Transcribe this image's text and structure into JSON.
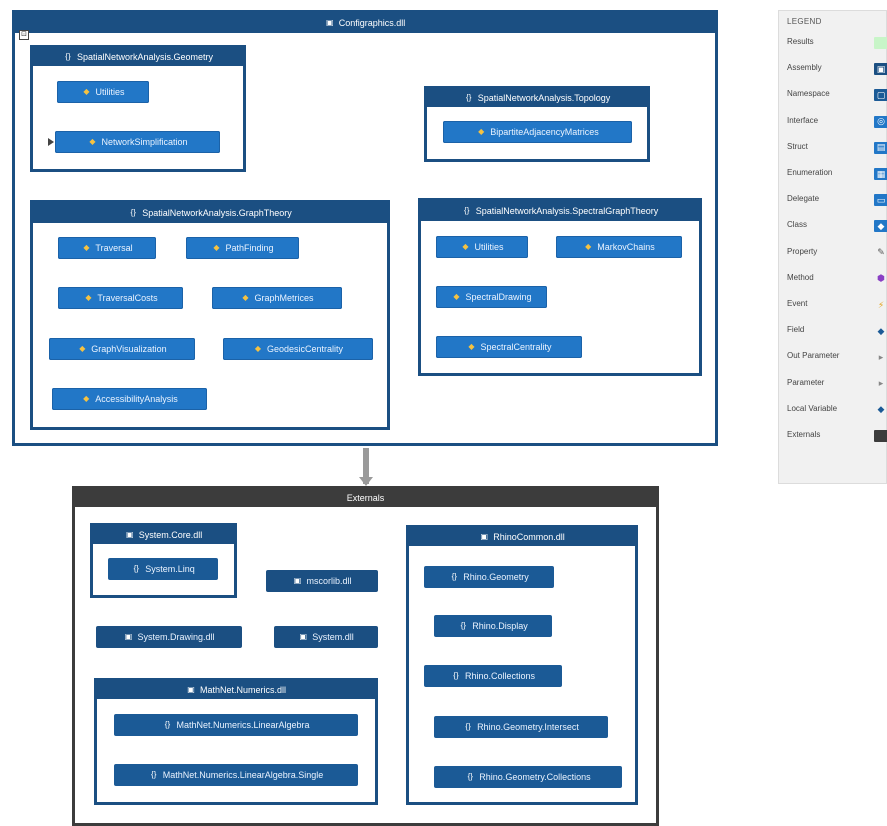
{
  "main_assembly": {
    "title": "Configraphics.dll",
    "geometry_ns": {
      "title": "SpatialNetworkAnalysis.Geometry",
      "classes": [
        "Utilities",
        "NetworkSimplification"
      ]
    },
    "topology_ns": {
      "title": "SpatialNetworkAnalysis.Topology",
      "classes": [
        "BipartiteAdjacencyMatrices"
      ]
    },
    "graphtheory_ns": {
      "title": "SpatialNetworkAnalysis.GraphTheory",
      "classes": [
        "Traversal",
        "PathFinding",
        "TraversalCosts",
        "GraphMetrices",
        "GraphVisualization",
        "GeodesicCentrality",
        "AccessibilityAnalysis"
      ]
    },
    "spectral_ns": {
      "title": "SpatialNetworkAnalysis.SpectralGraphTheory",
      "classes": [
        "Utilities",
        "MarkovChains",
        "SpectralDrawing",
        "SpectralCentrality"
      ]
    }
  },
  "externals": {
    "title": "Externals",
    "system_core": {
      "title": "System.Core.dll",
      "namespaces": [
        "System.Linq"
      ]
    },
    "mscorlib": "mscorlib.dll",
    "system_drawing": "System.Drawing.dll",
    "system": "System.dll",
    "mathnet": {
      "title": "MathNet.Numerics.dll",
      "namespaces": [
        "MathNet.Numerics.LinearAlgebra",
        "MathNet.Numerics.LinearAlgebra.Single"
      ]
    },
    "rhinocommon": {
      "title": "RhinoCommon.dll",
      "namespaces": [
        "Rhino.Geometry",
        "Rhino.Display",
        "Rhino.Collections",
        "Rhino.Geometry.Intersect",
        "Rhino.Geometry.Collections"
      ]
    }
  },
  "legend": {
    "title": "LEGEND",
    "items": [
      {
        "label": "Results",
        "icon": "results-swatch",
        "color": "#c8f5c8"
      },
      {
        "label": "Assembly",
        "icon": "assembly-icon",
        "color": "#1b4f82"
      },
      {
        "label": "Namespace",
        "icon": "namespace-icon",
        "color": "#1b5a96"
      },
      {
        "label": "Interface",
        "icon": "interface-icon",
        "color": "#2277c7"
      },
      {
        "label": "Struct",
        "icon": "struct-icon",
        "color": "#2277c7"
      },
      {
        "label": "Enumeration",
        "icon": "enumeration-icon",
        "color": "#2277c7"
      },
      {
        "label": "Delegate",
        "icon": "delegate-icon",
        "color": "#2277c7"
      },
      {
        "label": "Class",
        "icon": "class-icon",
        "color": "#2277c7"
      },
      {
        "label": "Property",
        "icon": "property-icon",
        "color": "#555555"
      },
      {
        "label": "Method",
        "icon": "method-icon",
        "color": "#8a3fc4"
      },
      {
        "label": "Event",
        "icon": "event-icon",
        "color": "#e3a21a"
      },
      {
        "label": "Field",
        "icon": "field-icon",
        "color": "#1b5a96"
      },
      {
        "label": "Out Parameter",
        "icon": "out-parameter-icon",
        "color": "#888888"
      },
      {
        "label": "Parameter",
        "icon": "parameter-icon",
        "color": "#888888"
      },
      {
        "label": "Local Variable",
        "icon": "local-variable-icon",
        "color": "#1b5a96"
      },
      {
        "label": "Externals",
        "icon": "externals-swatch",
        "color": "#3c3c3c"
      }
    ]
  },
  "colors": {
    "assembly": "#1b4f82",
    "class_box": "#2277c7",
    "externals_header": "#3c3c3c",
    "connector": "#9a9a9a"
  }
}
